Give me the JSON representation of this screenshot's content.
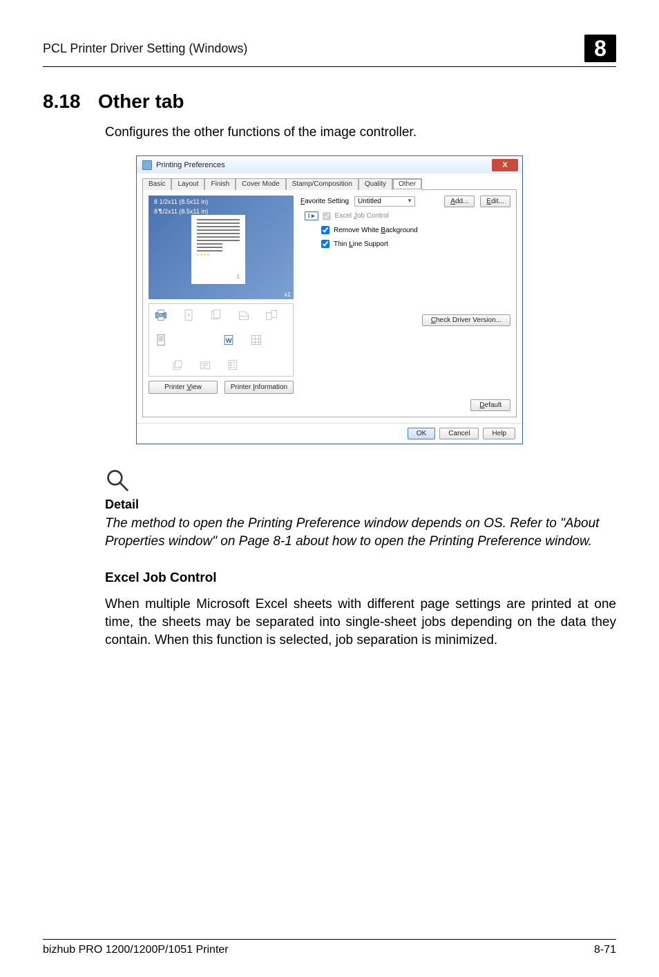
{
  "header": {
    "title": "PCL Printer Driver Setting (Windows)",
    "chapter": "8"
  },
  "section": {
    "number": "8.18",
    "title": "Other tab"
  },
  "intro": "Configures the other functions of the image controller.",
  "dialog": {
    "title": "Printing Preferences",
    "close": "X",
    "tabs": {
      "t0": "Basic",
      "t1": "Layout",
      "t2": "Finish",
      "t3": "Cover Mode",
      "t4": "Stamp/Composition",
      "t5": "Quality",
      "t6": "Other"
    },
    "favorite": {
      "label": "Favorite Setting",
      "selected": "Untitled",
      "add": "Add...",
      "edit": "Edit..."
    },
    "options": {
      "excel": {
        "pre": "Excel ",
        "u": "J",
        "post": "ob Control"
      },
      "remove": {
        "pre": "Remove White ",
        "u": "B",
        "post": "ackground"
      },
      "thin": {
        "pre": "Thin ",
        "u": "L",
        "post": "ine Support"
      }
    },
    "preview": {
      "size1": "8 1/2x11 (8.5x11 in)",
      "size2": "8 1/2x11 (8.5x11 in)",
      "x1": "x1"
    },
    "printer_view": {
      "pre": "Printer ",
      "u": "V",
      "post": "iew"
    },
    "printer_info": {
      "pre": "Printer ",
      "u": "I",
      "post": "nformation"
    },
    "check_version": {
      "u": "C",
      "post": "heck Driver Version..."
    },
    "default": {
      "u": "D",
      "post": "efault"
    },
    "buttons": {
      "ok": "OK",
      "cancel": "Cancel",
      "help": "Help"
    }
  },
  "detail": {
    "heading": "Detail",
    "body": "The method to open the Printing Preference window depends on OS. Refer to \"About Properties window\" on Page 8-1 about how to open the Printing Preference window."
  },
  "excel_section": {
    "heading": "Excel Job Control",
    "body": "When multiple Microsoft Excel sheets with different page settings are printed at one time, the sheets may be separated into single-sheet jobs depending on the data they contain. When this function is selected, job separation is minimized."
  },
  "footer": {
    "left": "bizhub PRO 1200/1200P/1051 Printer",
    "right": "8-71"
  }
}
